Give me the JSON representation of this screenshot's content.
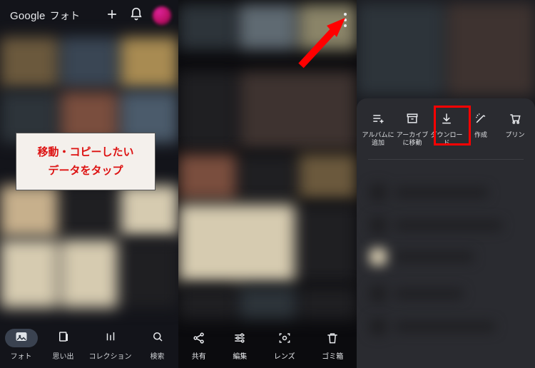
{
  "brand": {
    "google": "Google",
    "product": "フォト"
  },
  "callout": {
    "line1": "移動・コピーしたい",
    "line2": "データをタップ"
  },
  "panel1_nav": {
    "photos": "フォト",
    "memories": "思い出",
    "collection": "コレクション",
    "search": "検索"
  },
  "panel2_actions": {
    "share": "共有",
    "edit": "編集",
    "lens": "レンズ",
    "trash": "ゴミ箱"
  },
  "sheet": {
    "add_to_album": "アルバムに追加",
    "move_to_archive": "アーカイブに移動",
    "download": "ダウンロード",
    "create": "作成",
    "print": "プリン"
  }
}
